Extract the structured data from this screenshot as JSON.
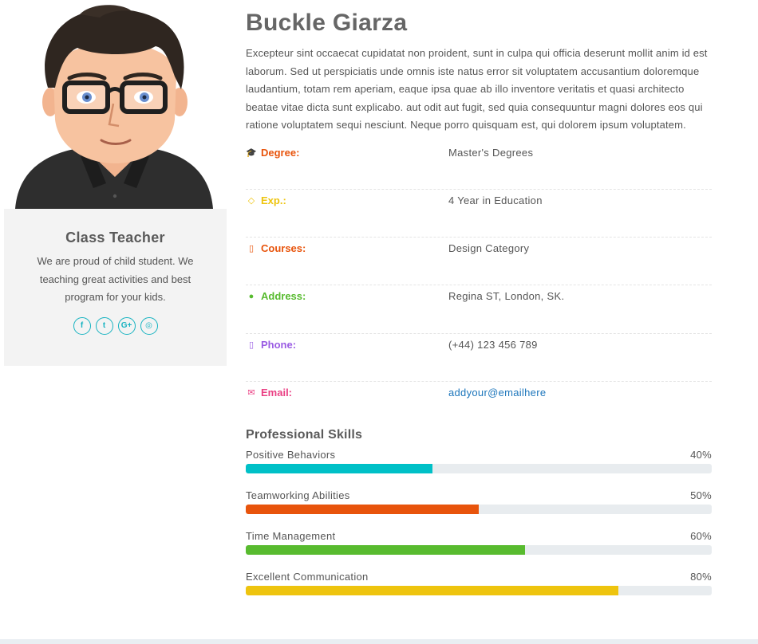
{
  "profile": {
    "name": "Buckle Giarza",
    "bio": "Excepteur sint occaecat cupidatat non proident, sunt in culpa qui officia deserunt mollit anim id est laborum. Sed ut perspiciatis unde omnis iste natus error sit voluptatem accusantium doloremque laudantium, totam rem aperiam, eaque ipsa quae ab illo inventore veritatis et quasi architecto beatae vitae dicta sunt explicabo. aut odit aut fugit, sed quia consequuntur magni dolores eos qui ratione voluptatem sequi nesciunt. Neque porro quisquam est, qui dolorem ipsum voluptatem."
  },
  "card": {
    "title": "Class Teacher",
    "text": "We are proud of child student. We teaching great activities and best program for your kids.",
    "socials": [
      {
        "icon": "facebook-icon",
        "glyph": "f"
      },
      {
        "icon": "twitter-icon",
        "glyph": "t"
      },
      {
        "icon": "google-plus-icon",
        "glyph": "G+"
      },
      {
        "icon": "instagram-icon",
        "glyph": "◎"
      }
    ]
  },
  "details": [
    {
      "key": "Degree:",
      "value": "Master's Degrees",
      "icon": "graduation-cap-icon",
      "glyph": "🎓",
      "color": "#e8540c",
      "link": false
    },
    {
      "key": "Exp.:",
      "value": "4 Year in Education",
      "icon": "diamond-icon",
      "glyph": "◇",
      "color": "#eec40e",
      "link": false
    },
    {
      "key": "Courses:",
      "value": "Design Category",
      "icon": "file-icon",
      "glyph": "▯",
      "color": "#e8540c",
      "link": false
    },
    {
      "key": "Address:",
      "value": "Regina ST, London, SK.",
      "icon": "map-marker-icon",
      "glyph": "●",
      "color": "#58bb2f",
      "link": false
    },
    {
      "key": "Phone:",
      "value": "(+44) 123 456 789",
      "icon": "mobile-icon",
      "glyph": "▯",
      "color": "#9a5ce3",
      "link": false
    },
    {
      "key": "Email:",
      "value": "addyour@emailhere",
      "icon": "envelope-icon",
      "glyph": "✉",
      "color": "#ea3f83",
      "link": true
    }
  ],
  "skills": {
    "title": "Professional Skills",
    "items": [
      {
        "label": "Positive Behaviors",
        "percent_label": "40%",
        "percent": 40,
        "color": "#00c0c7"
      },
      {
        "label": "Teamworking Abilities",
        "percent_label": "50%",
        "percent": 50,
        "color": "#e8540c"
      },
      {
        "label": "Time Management",
        "percent_label": "60%",
        "percent": 60,
        "color": "#58bb2f"
      },
      {
        "label": "Excellent Communication",
        "percent_label": "80%",
        "percent": 80,
        "color": "#eec40e"
      }
    ]
  }
}
